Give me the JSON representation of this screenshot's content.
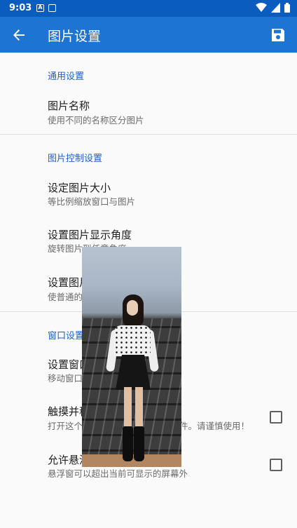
{
  "status_bar": {
    "time": "9:03",
    "notif_a": "A"
  },
  "app_bar": {
    "title": "图片设置",
    "back_icon": "arrow-back-icon",
    "save_icon": "save-icon"
  },
  "sections": [
    {
      "header": "通用设置",
      "items": [
        {
          "title": "图片名称",
          "summary": "使用不同的名称区分图片"
        }
      ]
    },
    {
      "header": "图片控制设置",
      "items": [
        {
          "title": "设定图片大小",
          "summary": "等比例缩放窗口与图片"
        },
        {
          "title": "设置图片显示角度",
          "summary": "旋转图片到任意角度"
        },
        {
          "title": "设置图片",
          "summary": "使普通的"
        }
      ]
    },
    {
      "header": "窗口设置",
      "items": [
        {
          "title": "设置窗口",
          "summary": "移动窗口"
        },
        {
          "title": "触摸并移",
          "summary": "打开这个",
          "summary_tail": "件。请谨慎使用！",
          "checked": false
        },
        {
          "title": "允许悬浮",
          "summary": "悬浮窗可以超出当前可显示的屏幕外",
          "checked": false
        }
      ]
    }
  ],
  "colors": {
    "status_bar": "#0b5cbf",
    "app_bar": "#1e74d3",
    "accent": "#1a5fd1"
  }
}
